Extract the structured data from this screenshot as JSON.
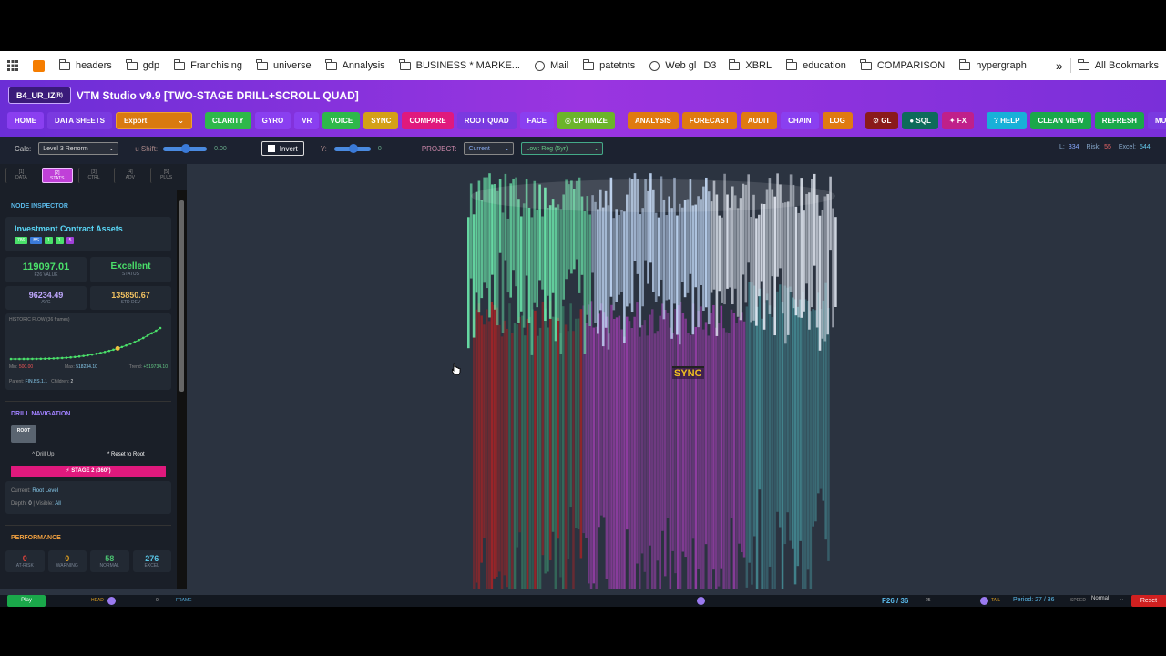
{
  "bookmarks": [
    "headers",
    "gdp",
    "Franchising",
    "universe",
    "Annalysis",
    "BUSINESS * MARKE...",
    "Mail",
    "patetnts",
    "Web gl",
    "D3",
    "XBRL",
    "education",
    "COMPARISON",
    "hypergraph"
  ],
  "all_bookmarks": "All Bookmarks",
  "chevron": "»",
  "app": {
    "badge": "B4_UR_IZ",
    "badge_sup": "(R)",
    "title": "VTM Studio v9.9 [TWO-STAGE DRILL+SCROLL QUAD]"
  },
  "toolbar": [
    {
      "label": "HOME",
      "color": "#8a3ff0"
    },
    {
      "label": "DATA SHEETS",
      "color": "#7a3ae0"
    },
    {
      "label": "Export ",
      "color": "#d97a10"
    },
    {
      "label": "CLARITY",
      "color": "#2eb84a"
    },
    {
      "label": "GYRO",
      "color": "#8a3ff0"
    },
    {
      "label": "VR",
      "color": "#8a3ff0"
    },
    {
      "label": "VOICE",
      "color": "#2eb84a"
    },
    {
      "label": "SYNC",
      "color": "#d4a017"
    },
    {
      "label": "COMPARE",
      "color": "#e0197d"
    },
    {
      "label": "ROOT QUAD",
      "color": "#7a3ae0"
    },
    {
      "label": "FACE",
      "color": "#8a3ff0"
    },
    {
      "label": "◎ OPTIMIZE",
      "color": "#6bb42a"
    },
    {
      "label": "ANALYSIS",
      "color": "#e07a10"
    },
    {
      "label": "FORECAST",
      "color": "#e07a10"
    },
    {
      "label": "AUDIT",
      "color": "#e07a10"
    },
    {
      "label": "CHAIN",
      "color": "#8a3ff0"
    },
    {
      "label": "LOG",
      "color": "#e07a10"
    },
    {
      "label": "⚙ GL",
      "color": "#8a1a1a"
    },
    {
      "label": "● SQL",
      "color": "#0e6b5a"
    },
    {
      "label": "✦ FX",
      "color": "#c0208a"
    },
    {
      "label": "? HELP",
      "color": "#18b0d8"
    },
    {
      "label": "CLEAN VIEW",
      "color": "#1aa84a"
    },
    {
      "label": "REFRESH",
      "color": "#1aa84a"
    },
    {
      "label": "MULTI",
      "color": "#7a3ae0"
    }
  ],
  "controls": {
    "calc_label": "Calc:",
    "calc_value": "Level 3 Renorm",
    "ushift_label": "u Shift:",
    "ushift_value": "0.00",
    "invert": "Invert",
    "y_label": "Y:",
    "y_value": "0",
    "project_label": "PROJECT:",
    "project_value": "Current",
    "low_value": "Low: Reg (5yr)"
  },
  "stats": {
    "l_label": "L:",
    "l": "334",
    "risk_label": "Risk:",
    "risk": "55",
    "excel_label": "Excel:",
    "excel": "544"
  },
  "side_tabs": [
    {
      "num": "[1]",
      "label": "DATA"
    },
    {
      "num": "[2]",
      "label": "STATS"
    },
    {
      "num": "[3]",
      "label": "CTRL"
    },
    {
      "num": "[4]",
      "label": "ADV"
    },
    {
      "num": "[5]",
      "label": "PLUS"
    }
  ],
  "inspector": {
    "heading": "NODE INSPECTOR",
    "name": "Investment Contract Assets",
    "tags": [
      "786",
      "BS",
      "1",
      "1",
      "5"
    ],
    "value": "119097.01",
    "value_label": "F26 VALUE",
    "status": "Excellent",
    "status_label": "STATUS",
    "avg": "96234.49",
    "avg_label": "AVG",
    "std": "135850.67",
    "std_label": "STD DEV",
    "flow_title": "HISTORIC FLOW (36 frames)",
    "min_label": "Min:",
    "min": "500.00",
    "max_label": "Max:",
    "max": "518234.10",
    "trend_label": "Trend:",
    "trend": "+519734.10",
    "parent_label": "Parent:",
    "parent": "FIN.BS.1.1",
    "children_label": "Children:",
    "children": "2"
  },
  "drill": {
    "heading": "DRILL NAVIGATION",
    "root": "ROOT",
    "up": "^ Drill Up",
    "reset": "* Reset to Root",
    "stage": "⚡ STAGE 2 (360°)",
    "current_label": "Current:",
    "current": "Root Level",
    "depth_label": "Depth:",
    "depth": "0",
    "visible_label": "| Visible:",
    "visible": "All"
  },
  "performance": {
    "heading": "PERFORMANCE",
    "items": [
      {
        "value": "0",
        "label": "AT-RISK",
        "color": "#e0443c"
      },
      {
        "value": "0",
        "label": "WARNING",
        "color": "#e0a020"
      },
      {
        "value": "58",
        "label": "NORMAL",
        "color": "#4ac070"
      },
      {
        "value": "276",
        "label": "EXCEL",
        "color": "#5ac8e8"
      }
    ]
  },
  "viewport": {
    "sync_label": "SYNC"
  },
  "bottom": {
    "play": "Play",
    "head": "HEAD",
    "head_val": "0",
    "frame": "FRAME",
    "frame_pos": "F26 / 36",
    "frame_num": "25",
    "tail": "TAIL",
    "period": "Period: 27 / 36",
    "speed": "SPEED",
    "speed_val": "Normal",
    "reset": "Reset"
  },
  "colors": {
    "accent": "#9a35e0",
    "viewport_bg": "#2b3340",
    "panel_bg": "#1a1f28"
  }
}
